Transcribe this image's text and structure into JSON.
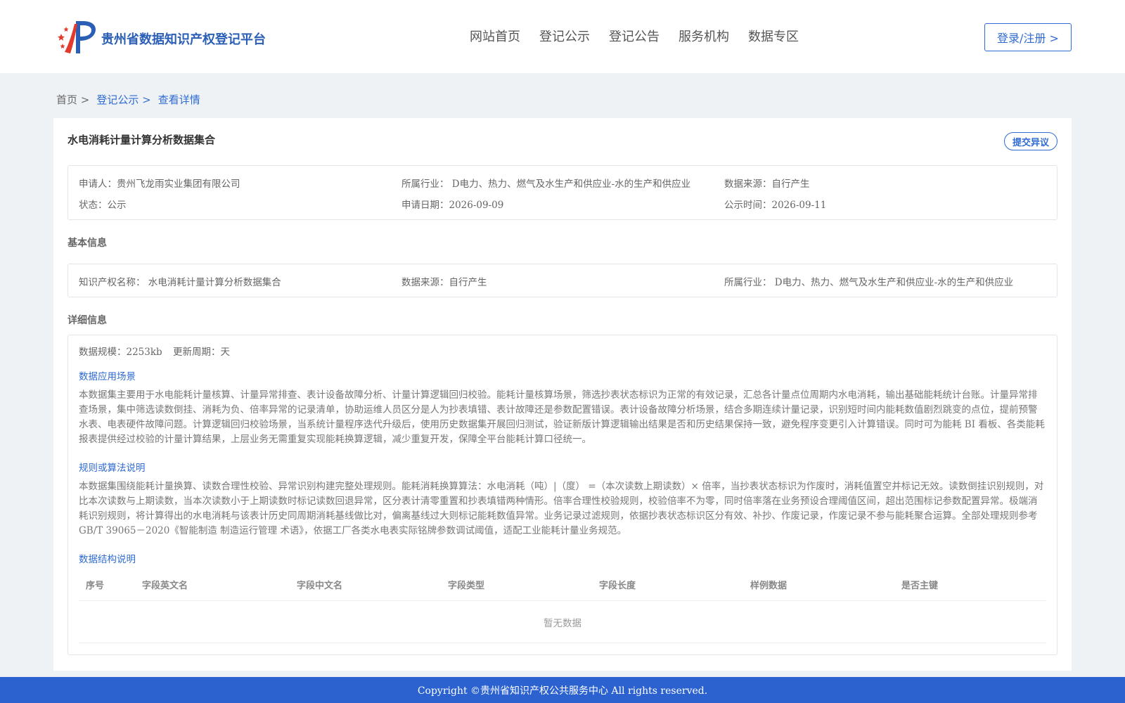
{
  "header": {
    "brand": "贵州省数据知识产权登记平台",
    "nav": [
      "网站首页",
      "登记公示",
      "登记公告",
      "服务机构",
      "数据专区"
    ],
    "login": "登录/注册 >"
  },
  "breadcrumb": {
    "home": "首页 >",
    "list": "登记公示 >",
    "current": "查看详情"
  },
  "title": "水电消耗计量计算分析数据集合",
  "dispute_button": "提交异议",
  "summary": {
    "applicant": "申请人：贵州飞龙雨实业集团有限公司",
    "industry": "所属行业： D电力、热力、燃气及水生产和供应业-水的生产和供应业",
    "source": "数据来源：自行产生",
    "status": "状态：公示",
    "apply_date": "申请日期：2026-09-09",
    "publish_date": "公示时间：2026-09-11"
  },
  "basic_info": {
    "title": "基本信息",
    "ip_name": "知识产权名称： 水电消耗计量计算分析数据集合",
    "source": "数据来源：自行产生",
    "industry": "所属行业： D电力、热力、燃气及水生产和供应业-水的生产和供应业"
  },
  "detail_info": {
    "title": "详细信息",
    "scale": "数据规模：2253kb",
    "cycle": "更新周期：天",
    "scenario_title": "数据应用场景",
    "scenario_text": "本数据集主要用于水电能耗计量核算、计量异常排查、表计设备故障分析、计量计算逻辑回归校验。能耗计量核算场景，筛选抄表状态标识为正常的有效记录，汇总各计量点位周期内水电消耗，输出基础能耗统计台账。计量异常排查场景，集中筛选读数倒挂、消耗为负、倍率异常的记录清单，协助运维人员区分是人为抄表填错、表计故障还是参数配置错误。表计设备故障分析场景，结合多期连续计量记录，识别短时间内能耗数值剧烈跳变的点位，提前预警水表、电表硬件故障问题。计算逻辑回归校验场景，当系统计量程序迭代升级后，使用历史数据集开展回归测试，验证新版计算逻辑输出结果是否和历史结果保持一致，避免程序变更引入计算错误。同时可为能耗 BI 看板、各类能耗报表提供经过校验的计量计算结果，上层业务无需重复实现能耗换算逻辑，减少重复开发，保障全平台能耗计算口径统一。",
    "rules_title": "规则或算法说明",
    "rules_text": "本数据集围绕能耗计量换算、读数合理性校验、异常识别构建完整处理规则。能耗消耗换算算法：水电消耗（吨）|（度） =（本次读数上期读数）× 倍率，当抄表状态标识为作废时，消耗值置空并标记无效。读数倒挂识别规则，对比本次读数与上期读数，当本次读数小于上期读数时标记读数回退异常，区分表计清零重置和抄表填错两种情形。倍率合理性校验规则，校验倍率不为零，同时倍率落在业务预设合理阈值区间，超出范围标记参数配置异常。极端消耗识别规则，将计算得出的水电消耗与该表计历史同周期消耗基线做比对，偏离基线过大则标记能耗数值异常。业务记录过滤规则，依据抄表状态标识区分有效、补抄、作废记录，作废记录不参与能耗聚合运算。全部处理规则参考 GB/T 39065－2020《智能制造 制造运行管理 术语》，依据工厂各类水电表实际铭牌参数调试阈值，适配工业能耗计量业务规范。",
    "structure_title": "数据结构说明",
    "table_headers": [
      "序号",
      "字段英文名",
      "字段中文名",
      "字段类型",
      "字段长度",
      "样例数据",
      "是否主键"
    ],
    "empty_text": "暂无数据"
  },
  "footer": "Copyright ©贵州省知识产权公共服务中心 All rights reserved.",
  "colors": {
    "primary": "#2f6bd1",
    "footer_bg": "#2b62cf",
    "page_bg": "#eef2f5",
    "logo_red": "#e23b2e",
    "logo_blue": "#2b5fb6"
  }
}
